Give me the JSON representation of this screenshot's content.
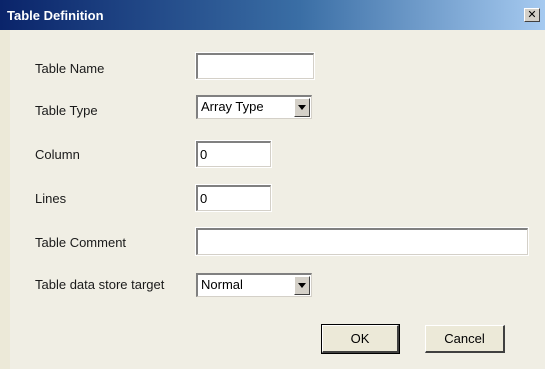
{
  "window": {
    "title": "Table Definition",
    "close_glyph": "✕"
  },
  "form": {
    "table_name": {
      "label": "Table Name",
      "value": ""
    },
    "table_type": {
      "label": "Table Type",
      "value": "Array Type"
    },
    "column": {
      "label": "Column",
      "value": "0"
    },
    "lines": {
      "label": "Lines",
      "value": "0"
    },
    "table_comment": {
      "label": "Table Comment",
      "value": ""
    },
    "store_target": {
      "label": "Table data store target",
      "value": "Normal"
    }
  },
  "buttons": {
    "ok": "OK",
    "cancel": "Cancel"
  },
  "colors": {
    "titlebar_start": "#0a246a",
    "titlebar_end": "#a6caf0",
    "dialog_bg": "#ece9d8"
  },
  "icons": [
    "close-icon",
    "dropdown-arrow-icon"
  ]
}
